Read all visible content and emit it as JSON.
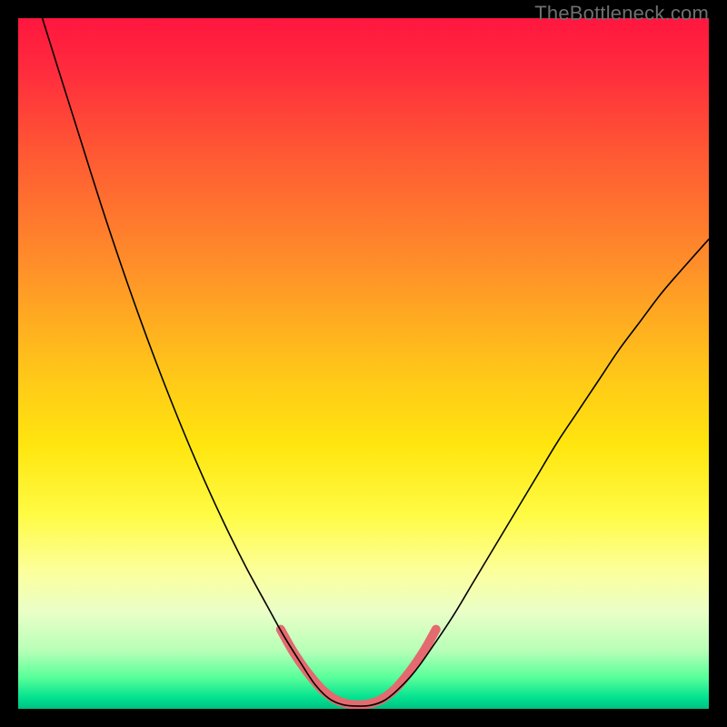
{
  "watermark": "TheBottleneck.com",
  "chart_data": {
    "type": "line",
    "title": "",
    "xlabel": "",
    "ylabel": "",
    "xlim": [
      0,
      100
    ],
    "ylim": [
      0,
      100
    ],
    "background_gradient": {
      "stops": [
        {
          "offset": 0.0,
          "color": "#ff163f"
        },
        {
          "offset": 0.08,
          "color": "#ff2d3d"
        },
        {
          "offset": 0.2,
          "color": "#ff5a33"
        },
        {
          "offset": 0.35,
          "color": "#ff8c2a"
        },
        {
          "offset": 0.5,
          "color": "#ffc21a"
        },
        {
          "offset": 0.62,
          "color": "#ffe60f"
        },
        {
          "offset": 0.72,
          "color": "#fffb45"
        },
        {
          "offset": 0.8,
          "color": "#fcff9a"
        },
        {
          "offset": 0.86,
          "color": "#eaffc8"
        },
        {
          "offset": 0.915,
          "color": "#b8ffb8"
        },
        {
          "offset": 0.955,
          "color": "#57ff9a"
        },
        {
          "offset": 0.985,
          "color": "#00e08f"
        },
        {
          "offset": 1.0,
          "color": "#00c083"
        }
      ]
    },
    "series": [
      {
        "name": "bottleneck-curve",
        "stroke": "#000000",
        "stroke_width": 1.6,
        "points": [
          {
            "x": 3.5,
            "y": 100.0
          },
          {
            "x": 6.0,
            "y": 92.0
          },
          {
            "x": 9.0,
            "y": 82.5
          },
          {
            "x": 12.0,
            "y": 73.0
          },
          {
            "x": 15.0,
            "y": 64.0
          },
          {
            "x": 18.0,
            "y": 55.5
          },
          {
            "x": 21.0,
            "y": 47.5
          },
          {
            "x": 24.0,
            "y": 40.0
          },
          {
            "x": 27.0,
            "y": 33.0
          },
          {
            "x": 30.0,
            "y": 26.5
          },
          {
            "x": 33.0,
            "y": 20.5
          },
          {
            "x": 36.0,
            "y": 15.0
          },
          {
            "x": 38.5,
            "y": 10.5
          },
          {
            "x": 41.0,
            "y": 6.5
          },
          {
            "x": 43.0,
            "y": 3.5
          },
          {
            "x": 45.0,
            "y": 1.5
          },
          {
            "x": 47.0,
            "y": 0.6
          },
          {
            "x": 49.0,
            "y": 0.4
          },
          {
            "x": 51.0,
            "y": 0.5
          },
          {
            "x": 53.0,
            "y": 1.2
          },
          {
            "x": 55.0,
            "y": 2.8
          },
          {
            "x": 57.5,
            "y": 5.5
          },
          {
            "x": 60.0,
            "y": 9.0
          },
          {
            "x": 63.0,
            "y": 13.5
          },
          {
            "x": 66.0,
            "y": 18.5
          },
          {
            "x": 69.0,
            "y": 23.5
          },
          {
            "x": 72.0,
            "y": 28.5
          },
          {
            "x": 75.0,
            "y": 33.5
          },
          {
            "x": 78.0,
            "y": 38.5
          },
          {
            "x": 81.0,
            "y": 43.0
          },
          {
            "x": 84.0,
            "y": 47.5
          },
          {
            "x": 87.0,
            "y": 52.0
          },
          {
            "x": 90.0,
            "y": 56.0
          },
          {
            "x": 93.0,
            "y": 60.0
          },
          {
            "x": 96.0,
            "y": 63.5
          },
          {
            "x": 100.0,
            "y": 68.0
          }
        ]
      },
      {
        "name": "highlight-band",
        "stroke": "#e46a6f",
        "stroke_width": 10,
        "linecap": "round",
        "points": [
          {
            "x": 38.0,
            "y": 11.5
          },
          {
            "x": 39.5,
            "y": 8.8
          },
          {
            "x": 41.0,
            "y": 6.5
          },
          {
            "x": 42.5,
            "y": 4.5
          },
          {
            "x": 44.0,
            "y": 2.8
          },
          {
            "x": 45.5,
            "y": 1.6
          },
          {
            "x": 47.0,
            "y": 0.9
          },
          {
            "x": 48.5,
            "y": 0.6
          },
          {
            "x": 50.0,
            "y": 0.6
          },
          {
            "x": 51.5,
            "y": 0.9
          },
          {
            "x": 53.0,
            "y": 1.6
          },
          {
            "x": 54.5,
            "y": 2.8
          },
          {
            "x": 56.0,
            "y": 4.5
          },
          {
            "x": 57.5,
            "y": 6.5
          },
          {
            "x": 59.0,
            "y": 8.8
          },
          {
            "x": 60.5,
            "y": 11.5
          }
        ]
      }
    ]
  }
}
